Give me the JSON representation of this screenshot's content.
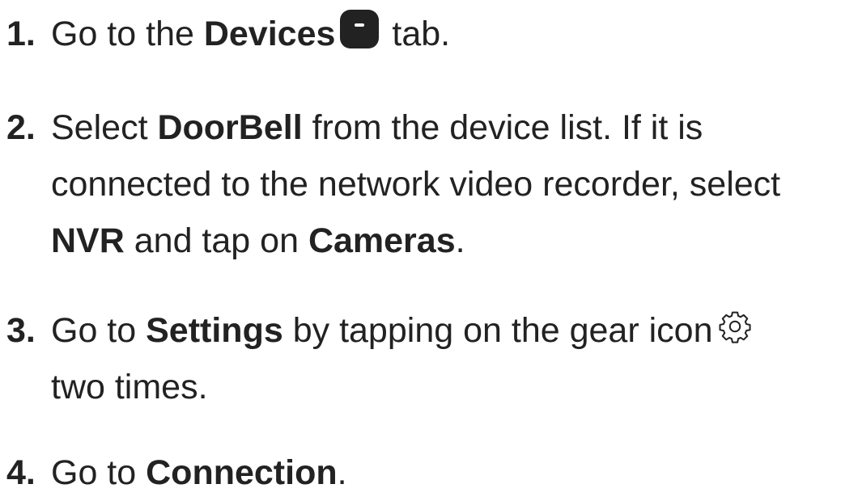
{
  "steps": [
    {
      "number": "1.",
      "t1": "Go to the ",
      "b1": "Devices",
      "icon": "devices-tab-icon",
      "t2": " tab."
    },
    {
      "number": "2.",
      "l1_t1": "Select ",
      "l1_b1": "DoorBell",
      "l1_t2": " from the device list. If it is",
      "l2": "connected to the network video recorder, select",
      "l3_b1": "NVR",
      "l3_t1": " and tap on ",
      "l3_b2": "Cameras",
      "l3_t2": "."
    },
    {
      "number": "3.",
      "l1_t1": "Go to ",
      "l1_b1": "Settings",
      "l1_t2": " by tapping on the gear icon",
      "icon": "gear-icon",
      "l2": "two times."
    },
    {
      "number": "4.",
      "t1": "Go to ",
      "b1": "Connection",
      "t2": "."
    }
  ],
  "colors": {
    "text": "#222222",
    "background": "#ffffff"
  }
}
